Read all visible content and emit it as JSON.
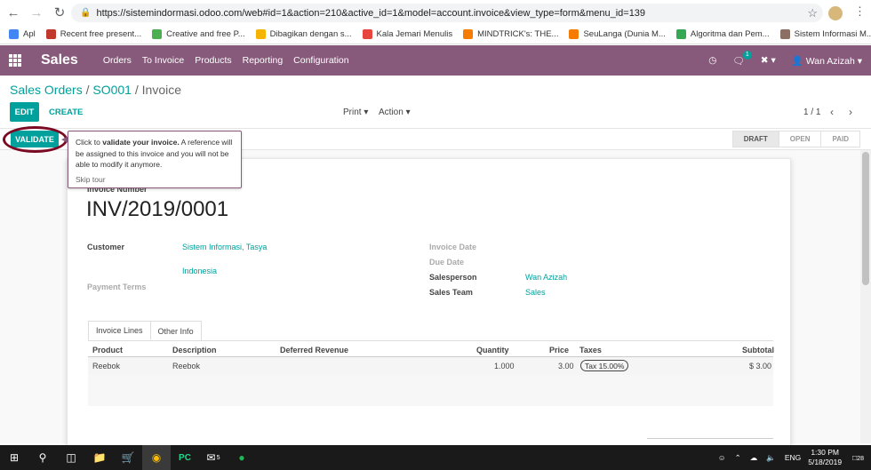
{
  "browser": {
    "url": "https://sistemindormasi.odoo.com/web#id=1&action=210&active_id=1&model=account.invoice&view_type=form&menu_id=139",
    "bookmarks": [
      {
        "label": "Apl",
        "color": "#e8453c"
      },
      {
        "label": "Recent free present...",
        "color": "#c0392b"
      },
      {
        "label": "Creative and free P...",
        "color": "#4caf50"
      },
      {
        "label": "Dibagikan dengan s...",
        "color": "#f4b400"
      },
      {
        "label": "Kala Jemari Menulis",
        "color": "#e8453c"
      },
      {
        "label": "MINDTRICK's: THE...",
        "color": "#f57c00"
      },
      {
        "label": "SeuLanga (Dunia M...",
        "color": "#f57c00"
      },
      {
        "label": "Algoritma dan Pem...",
        "color": "#34a853"
      },
      {
        "label": "Sistem Informasi M...",
        "color": "#8d6e63"
      }
    ]
  },
  "nav": {
    "brand": "Sales",
    "menu": [
      "Orders",
      "To Invoice",
      "Products",
      "Reporting",
      "Configuration"
    ],
    "chat_badge": "1",
    "user": "Wan Azizah"
  },
  "breadcrumb": {
    "part1": "Sales Orders",
    "sep1": " / ",
    "part2": "SO001",
    "sep2": " / ",
    "current": "Invoice"
  },
  "controls": {
    "edit": "EDIT",
    "create": "CREATE",
    "print": "Print",
    "action": "Action",
    "pager": "1 / 1"
  },
  "status": {
    "validate": "VALIDATE",
    "stages": [
      "DRAFT",
      "OPEN",
      "PAID"
    ],
    "active_stage": "DRAFT"
  },
  "tooltip": {
    "pre": "Click to ",
    "bold": "validate your invoice.",
    "post": " A reference will be assigned to this invoice and you will not be able to modify it anymore.",
    "skip": "Skip tour"
  },
  "invoice": {
    "number_label": "Invoice Number",
    "number": "INV/2019/0001",
    "customer_label": "Customer",
    "customer": "Sistem Informasi, Tasya",
    "country": "Indonesia",
    "payment_terms_label": "Payment Terms",
    "invoice_date_label": "Invoice Date",
    "due_date_label": "Due Date",
    "salesperson_label": "Salesperson",
    "salesperson": "Wan Azizah",
    "sales_team_label": "Sales Team",
    "sales_team": "Sales"
  },
  "tabs": [
    "Invoice Lines",
    "Other Info"
  ],
  "lines": {
    "headers": [
      "Product",
      "Description",
      "Deferred Revenue",
      "Quantity",
      "Price",
      "Taxes",
      "Subtotal"
    ],
    "rows": [
      {
        "product": "Reebok",
        "description": "Reebok",
        "deferred": "",
        "quantity": "1.000",
        "price": "3.00",
        "tax": "Tax 15.00%",
        "subtotal": "$ 3.00"
      }
    ]
  },
  "taskbar": {
    "time": "1:30 PM",
    "date": "5/18/2019",
    "lang": "ENG",
    "notif": "28",
    "mail_badge": "5"
  }
}
